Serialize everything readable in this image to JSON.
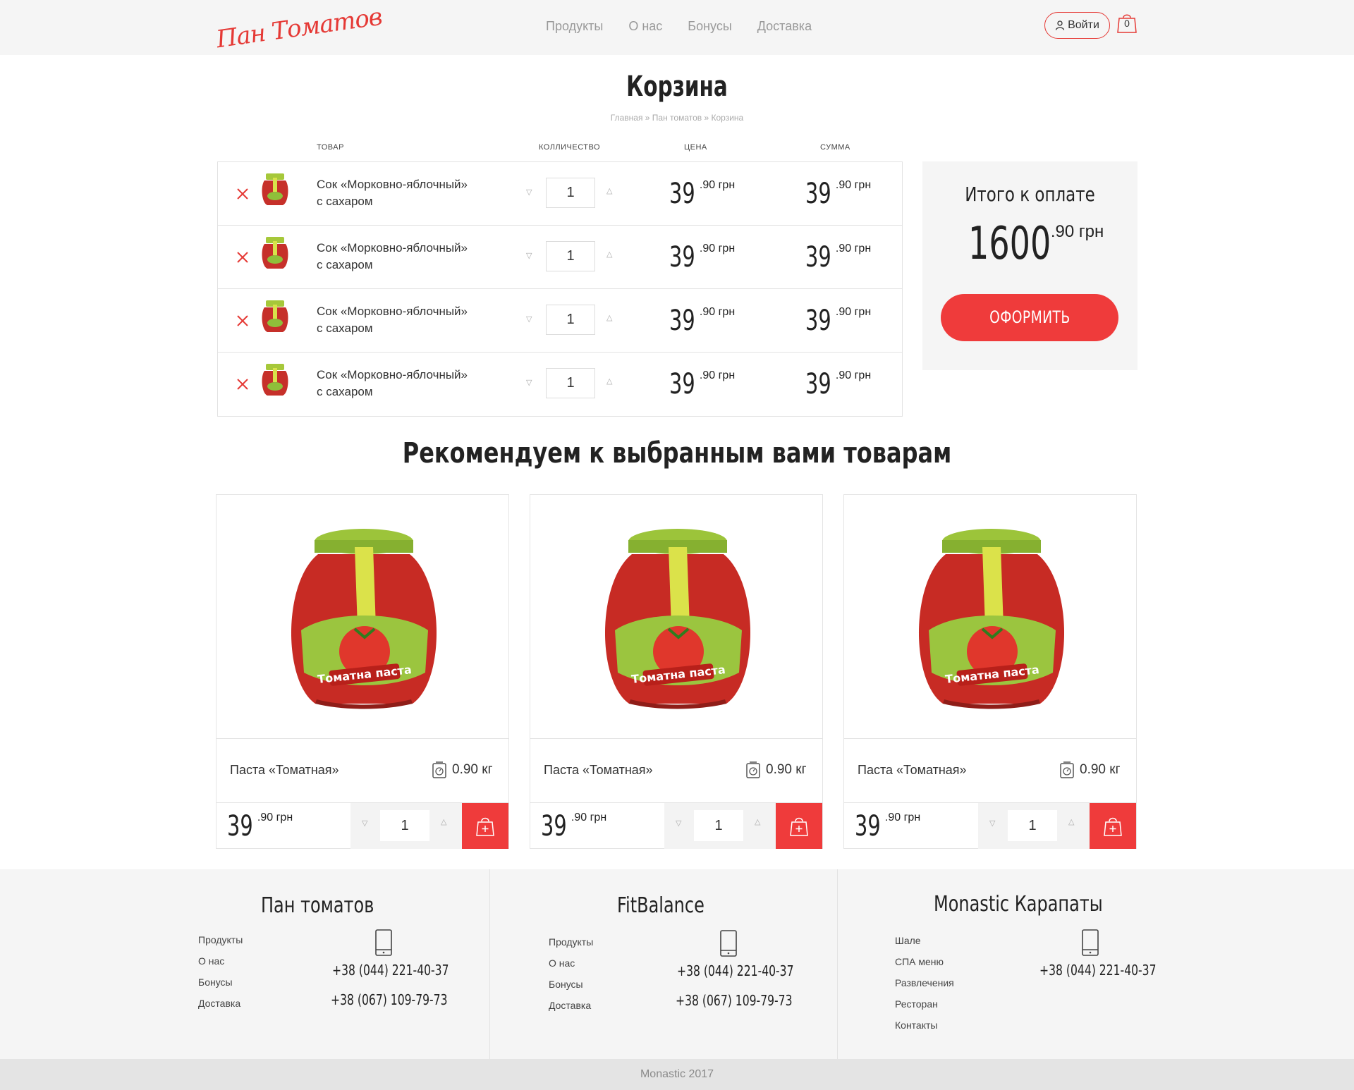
{
  "header": {
    "logo": "Пан Томатов",
    "nav": [
      "Продукты",
      "О нас",
      "Бонусы",
      "Доставка"
    ],
    "login": "Войти",
    "cart_count": "0"
  },
  "page": {
    "title": "Корзина",
    "breadcrumb": "Главная » Пан томатов » Корзина"
  },
  "cart": {
    "columns": [
      "ТОВАР",
      "КОЛЛИЧЕСТВО",
      "ЦЕНА",
      "СУММА"
    ],
    "rows": [
      {
        "name_line1": "Сок «Морковно-яблочный»",
        "name_line2": "с сахаром",
        "qty": "1",
        "price_int": "39",
        "price_frac": ".90 грн",
        "sum_int": "39",
        "sum_frac": ".90 грн"
      },
      {
        "name_line1": "Сок «Морковно-яблочный»",
        "name_line2": "с сахаром",
        "qty": "1",
        "price_int": "39",
        "price_frac": ".90 грн",
        "sum_int": "39",
        "sum_frac": ".90 грн"
      },
      {
        "name_line1": "Сок «Морковно-яблочный»",
        "name_line2": "с сахаром",
        "qty": "1",
        "price_int": "39",
        "price_frac": ".90 грн",
        "sum_int": "39",
        "sum_frac": ".90 грн"
      },
      {
        "name_line1": "Сок «Морковно-яблочный»",
        "name_line2": "с сахаром",
        "qty": "1",
        "price_int": "39",
        "price_frac": ".90 грн",
        "sum_int": "39",
        "sum_frac": ".90 грн"
      }
    ]
  },
  "total": {
    "label": "Итого к оплате",
    "amount_int": "1600",
    "amount_frac": ".90 грн",
    "checkout": "ОФОРМИТЬ"
  },
  "recommended": {
    "title": "Рекомендуем к выбранным вами товарам",
    "cards": [
      {
        "name": "Паста «Томатная»",
        "weight": "0.90 кг",
        "price_int": "39",
        "price_frac": ".90 грн",
        "qty": "1",
        "jar_label": "Томатна паста"
      },
      {
        "name": "Паста «Томатная»",
        "weight": "0.90 кг",
        "price_int": "39",
        "price_frac": ".90 грн",
        "qty": "1",
        "jar_label": "Томатна паста"
      },
      {
        "name": "Паста «Томатная»",
        "weight": "0.90 кг",
        "price_int": "39",
        "price_frac": ".90 грн",
        "qty": "1",
        "jar_label": "Томатна паста"
      }
    ]
  },
  "footer": {
    "columns": [
      {
        "title": "Пан томатов",
        "links": [
          "Продукты",
          "О нас",
          "Бонусы",
          "Доставка"
        ],
        "phones": [
          "+38 (044) 221-40-37",
          "+38 (067) 109-79-73"
        ]
      },
      {
        "title": "FitBalance",
        "links": [
          "Продукты",
          "О нас",
          "Бонусы",
          "Доставка"
        ],
        "phones": [
          "+38 (044) 221-40-37",
          "+38 (067) 109-79-73"
        ]
      },
      {
        "title": "Monastic Карапаты",
        "links": [
          "Шале",
          "СПА меню",
          "Развлечения",
          "Ресторан",
          "Контакты"
        ],
        "phones": [
          "+38 (044) 221-40-37"
        ]
      }
    ],
    "copyright": "Monastic 2017"
  },
  "colors": {
    "accent": "#ef3b3b",
    "header_bg": "#f5f5f5",
    "footer_bg": "#f5f5f5"
  },
  "icons": [
    "user-icon",
    "cart-icon",
    "remove-icon",
    "chevron-down-icon",
    "chevron-up-icon",
    "weight-scale-icon",
    "add-to-cart-icon",
    "phone-icon"
  ]
}
